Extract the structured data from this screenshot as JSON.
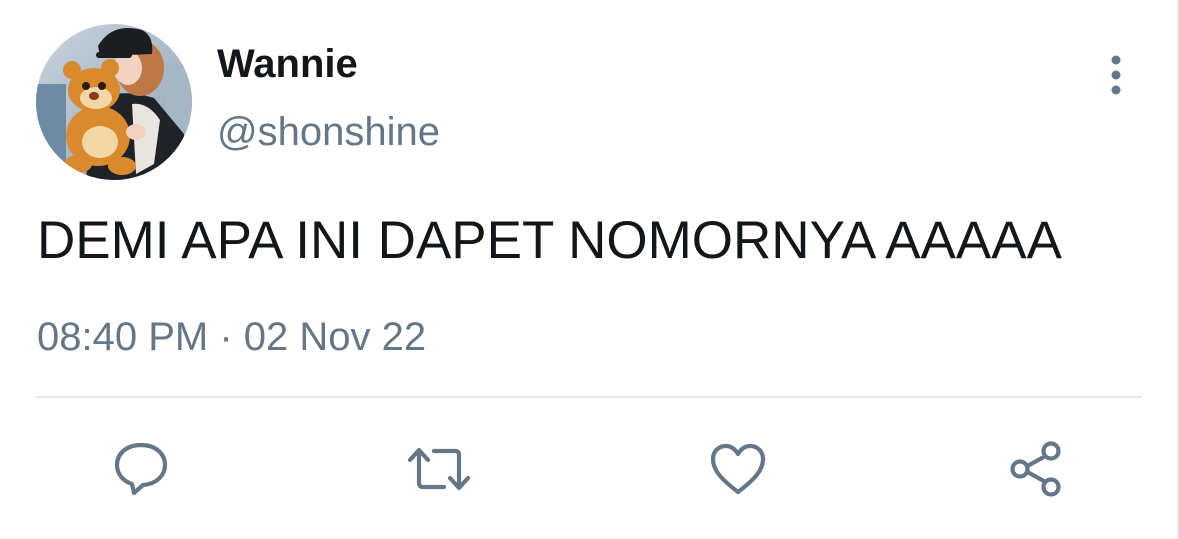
{
  "tweet": {
    "author_name": "Wannie",
    "author_handle": "@shonshine",
    "text": "DEMI APA INI DAPET NOMORNYA AAAAA",
    "time": "08:40 PM",
    "separator": "·",
    "date": "02 Nov 22"
  },
  "icons": {
    "more": "more-vertical-icon",
    "reply": "comment-bubble-icon",
    "retweet": "retweet-icon",
    "like": "heart-icon",
    "share": "share-icon"
  },
  "colors": {
    "text_primary": "#14171a",
    "text_secondary": "#657786",
    "icon": "#657786",
    "divider": "#e6e9ec"
  }
}
